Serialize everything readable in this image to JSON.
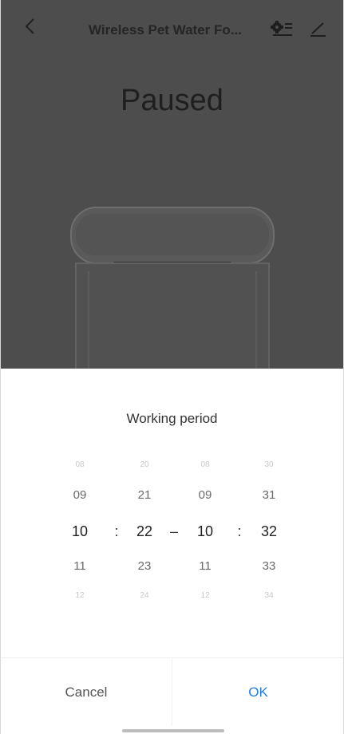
{
  "header": {
    "title": "Wireless Pet Water Fo...",
    "back_icon": "chevron-left-icon",
    "settings_icon": "gear-list-icon",
    "edit_icon": "pencil-icon"
  },
  "device": {
    "status": "Paused"
  },
  "dialog": {
    "title": "Working period",
    "start_hour": [
      "08",
      "09",
      "10",
      "11",
      "12",
      ""
    ],
    "start_minute": [
      "20",
      "21",
      "22",
      "23",
      "24",
      ""
    ],
    "end_hour": [
      "08",
      "09",
      "10",
      "11",
      "12",
      ""
    ],
    "end_minute": [
      "30",
      "31",
      "32",
      "33",
      "34",
      ""
    ],
    "separator_colon": ":",
    "separator_dash": "–",
    "cancel_label": "Cancel",
    "ok_label": "OK"
  },
  "colors": {
    "overlay": "#4d4d4d",
    "accent": "#1f7fe0"
  }
}
